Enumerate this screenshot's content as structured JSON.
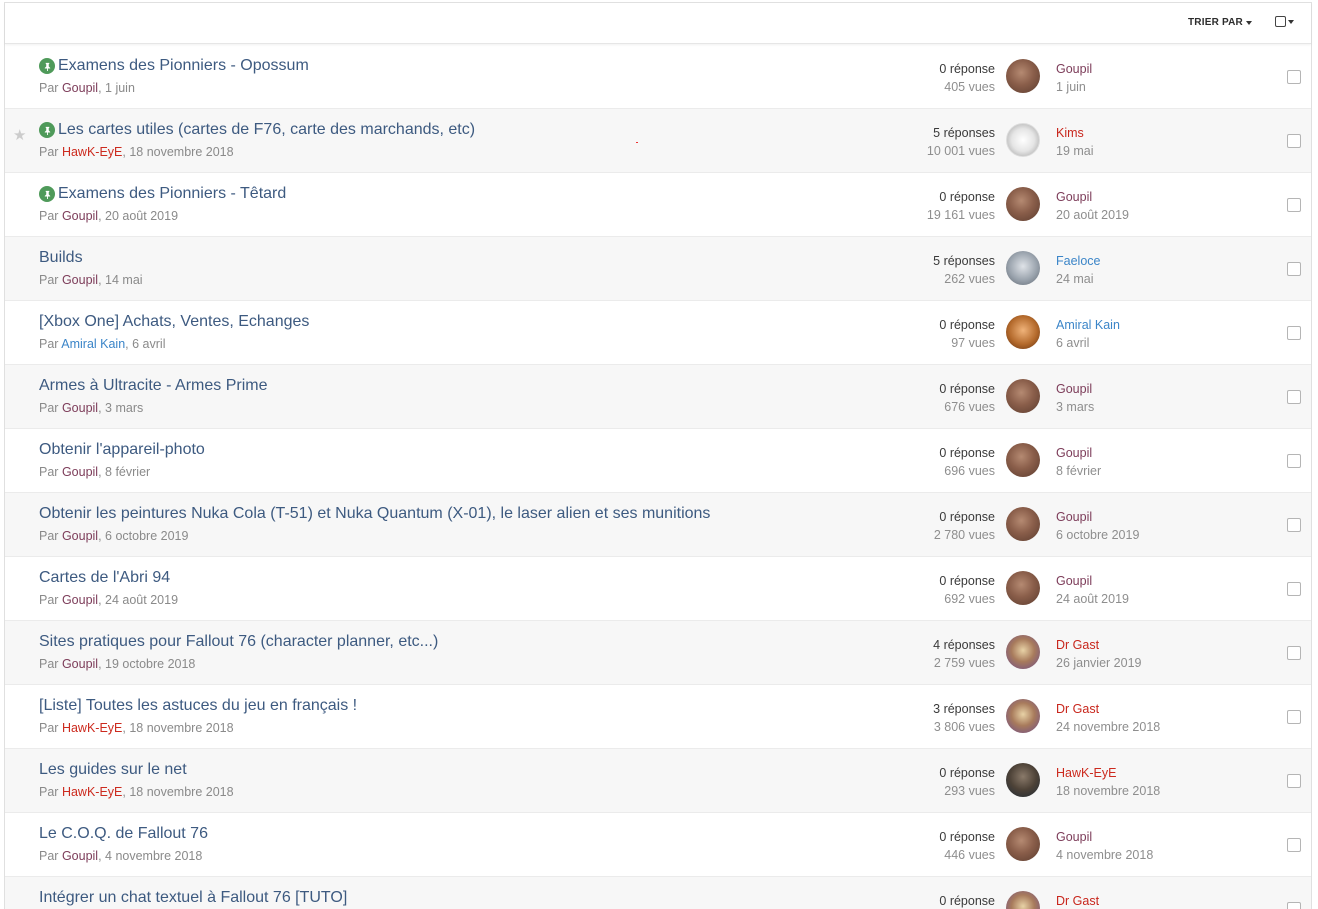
{
  "toolbar": {
    "sort_label": "TRIER PAR"
  },
  "by_prefix": "Par",
  "rows": [
    {
      "pinned": true,
      "starred": false,
      "title": "Examens des Pionniers - Opossum",
      "author": "Goupil",
      "author_color": "goupil",
      "date": "1 juin",
      "replies": "0 réponse",
      "views": "405 vues",
      "last_user": "Goupil",
      "last_color": "goupil",
      "last_avatar": "goupil",
      "last_date": "1 juin"
    },
    {
      "pinned": true,
      "starred": true,
      "title": "Les cartes utiles (cartes de F76, carte des marchands, etc)",
      "author": "HawK-EyE",
      "author_color": "hawk",
      "date": "18 novembre 2018",
      "replies": "5 réponses",
      "views": "10 001 vues",
      "last_user": "Kims",
      "last_color": "kims",
      "last_avatar": "kims",
      "last_date": "19 mai"
    },
    {
      "pinned": true,
      "starred": false,
      "title": "Examens des Pionniers - Têtard",
      "author": "Goupil",
      "author_color": "goupil",
      "date": "20 août 2019",
      "replies": "0 réponse",
      "views": "19 161 vues",
      "last_user": "Goupil",
      "last_color": "goupil",
      "last_avatar": "goupil",
      "last_date": "20 août 2019"
    },
    {
      "pinned": false,
      "starred": false,
      "title": "Builds",
      "author": "Goupil",
      "author_color": "goupil",
      "date": "14 mai",
      "replies": "5 réponses",
      "views": "262 vues",
      "last_user": "Faeloce",
      "last_color": "blue",
      "last_avatar": "faeloce",
      "last_date": "24 mai"
    },
    {
      "pinned": false,
      "starred": false,
      "title": "[Xbox One] Achats, Ventes, Echanges",
      "author": "Amiral Kain",
      "author_color": "blue",
      "date": "6 avril",
      "replies": "0 réponse",
      "views": "97 vues",
      "last_user": "Amiral Kain",
      "last_color": "blue",
      "last_avatar": "amiral",
      "last_date": "6 avril"
    },
    {
      "pinned": false,
      "starred": false,
      "title": "Armes à Ultracite - Armes Prime",
      "author": "Goupil",
      "author_color": "goupil",
      "date": "3 mars",
      "replies": "0 réponse",
      "views": "676 vues",
      "last_user": "Goupil",
      "last_color": "goupil",
      "last_avatar": "goupil",
      "last_date": "3 mars"
    },
    {
      "pinned": false,
      "starred": false,
      "title": "Obtenir l'appareil-photo",
      "author": "Goupil",
      "author_color": "goupil",
      "date": "8 février",
      "replies": "0 réponse",
      "views": "696 vues",
      "last_user": "Goupil",
      "last_color": "goupil",
      "last_avatar": "goupil",
      "last_date": "8 février"
    },
    {
      "pinned": false,
      "starred": false,
      "title": "Obtenir les peintures Nuka Cola (T-51) et Nuka Quantum (X-01), le laser alien et ses munitions",
      "author": "Goupil",
      "author_color": "goupil",
      "date": "6 octobre 2019",
      "replies": "0 réponse",
      "views": "2 780 vues",
      "last_user": "Goupil",
      "last_color": "goupil",
      "last_avatar": "goupil",
      "last_date": "6 octobre 2019"
    },
    {
      "pinned": false,
      "starred": false,
      "title": "Cartes de l'Abri 94",
      "author": "Goupil",
      "author_color": "goupil",
      "date": "24 août 2019",
      "replies": "0 réponse",
      "views": "692 vues",
      "last_user": "Goupil",
      "last_color": "goupil",
      "last_avatar": "goupil",
      "last_date": "24 août 2019"
    },
    {
      "pinned": false,
      "starred": false,
      "title": "Sites pratiques pour Fallout 76 (character planner, etc...)",
      "author": "Goupil",
      "author_color": "goupil",
      "date": "19 octobre 2018",
      "replies": "4 réponses",
      "views": "2 759 vues",
      "last_user": "Dr Gast",
      "last_color": "drgast",
      "last_avatar": "drgast",
      "last_date": "26 janvier 2019"
    },
    {
      "pinned": false,
      "starred": false,
      "title": "[Liste] Toutes les astuces du jeu en français !",
      "author": "HawK-EyE",
      "author_color": "hawk",
      "date": "18 novembre 2018",
      "replies": "3 réponses",
      "views": "3 806 vues",
      "last_user": "Dr Gast",
      "last_color": "drgast",
      "last_avatar": "drgast",
      "last_date": "24 novembre 2018"
    },
    {
      "pinned": false,
      "starred": false,
      "title": "Les guides sur le net",
      "author": "HawK-EyE",
      "author_color": "hawk",
      "date": "18 novembre 2018",
      "replies": "0 réponse",
      "views": "293 vues",
      "last_user": "HawK-EyE",
      "last_color": "hawk",
      "last_avatar": "hawk",
      "last_date": "18 novembre 2018"
    },
    {
      "pinned": false,
      "starred": false,
      "title": "Le C.O.Q. de Fallout 76",
      "author": "Goupil",
      "author_color": "goupil",
      "date": "4 novembre 2018",
      "replies": "0 réponse",
      "views": "446 vues",
      "last_user": "Goupil",
      "last_color": "goupil",
      "last_avatar": "goupil",
      "last_date": "4 novembre 2018"
    },
    {
      "pinned": false,
      "starred": false,
      "title": "Intégrer un chat textuel à Fallout 76 [TUTO]",
      "author": "",
      "author_color": "goupil",
      "date": "",
      "replies": "0 réponse",
      "views": "",
      "last_user": "Dr Gast",
      "last_color": "drgast",
      "last_avatar": "drgast",
      "last_date": ""
    }
  ]
}
